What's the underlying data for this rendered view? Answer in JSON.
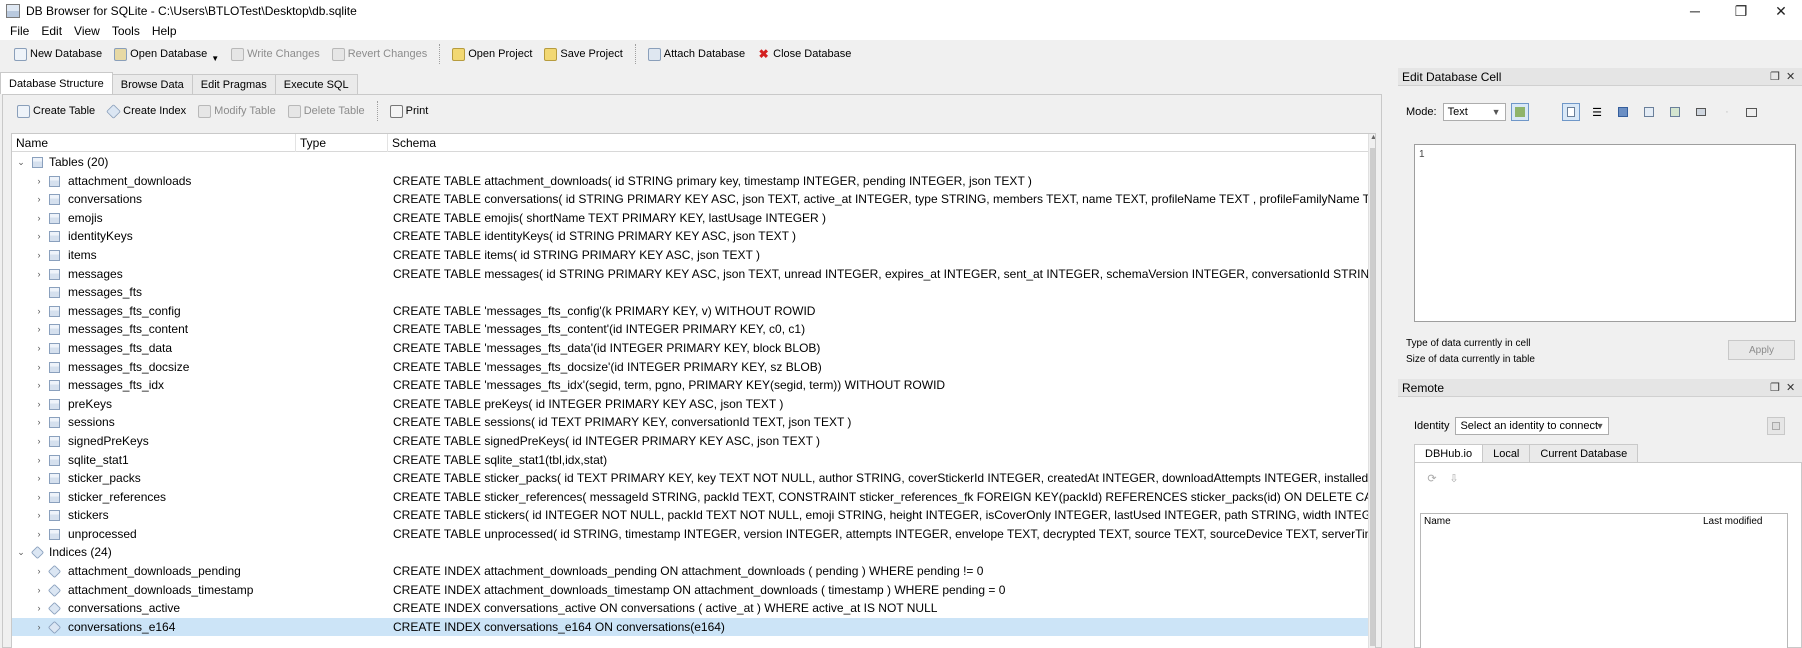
{
  "window": {
    "title": "DB Browser for SQLite - C:\\Users\\BTLOTest\\Desktop\\db.sqlite",
    "minimize": "─",
    "restore": "❐",
    "close": "✕"
  },
  "menu": [
    "File",
    "Edit",
    "View",
    "Tools",
    "Help"
  ],
  "toolbar": {
    "new_database": "New Database",
    "open_database": "Open Database",
    "write_changes": "Write Changes",
    "revert_changes": "Revert Changes",
    "open_project": "Open Project",
    "save_project": "Save Project",
    "attach_database": "Attach Database",
    "close_database": "Close Database"
  },
  "tabs": [
    "Database Structure",
    "Browse Data",
    "Edit Pragmas",
    "Execute SQL"
  ],
  "structure_toolbar": {
    "create_table": "Create Table",
    "create_index": "Create Index",
    "modify_table": "Modify Table",
    "delete_table": "Delete Table",
    "print": "Print"
  },
  "tree": {
    "headers": [
      "Name",
      "Type",
      "Schema"
    ],
    "tables_label": "Tables (20)",
    "tables": [
      {
        "name": "attachment_downloads",
        "schema": "CREATE TABLE attachment_downloads( id STRING primary key, timestamp INTEGER, pending INTEGER, json TEXT )"
      },
      {
        "name": "conversations",
        "schema": "CREATE TABLE conversations( id STRING PRIMARY KEY ASC, json TEXT, active_at INTEGER, type STRING, members TEXT, name TEXT, profileName TEXT , profileFamilyName TEXT"
      },
      {
        "name": "emojis",
        "schema": "CREATE TABLE emojis( shortName TEXT PRIMARY KEY, lastUsage INTEGER )"
      },
      {
        "name": "identityKeys",
        "schema": "CREATE TABLE identityKeys( id STRING PRIMARY KEY ASC, json TEXT )"
      },
      {
        "name": "items",
        "schema": "CREATE TABLE items( id STRING PRIMARY KEY ASC, json TEXT )"
      },
      {
        "name": "messages",
        "schema": "CREATE TABLE messages( id STRING PRIMARY KEY ASC, json TEXT, unread INTEGER, expires_at INTEGER, sent_at INTEGER, schemaVersion INTEGER, conversationId STRING, recei"
      },
      {
        "name": "messages_fts",
        "schema": ""
      },
      {
        "name": "messages_fts_config",
        "schema": "CREATE TABLE 'messages_fts_config'(k PRIMARY KEY, v) WITHOUT ROWID"
      },
      {
        "name": "messages_fts_content",
        "schema": "CREATE TABLE 'messages_fts_content'(id INTEGER PRIMARY KEY, c0, c1)"
      },
      {
        "name": "messages_fts_data",
        "schema": "CREATE TABLE 'messages_fts_data'(id INTEGER PRIMARY KEY, block BLOB)"
      },
      {
        "name": "messages_fts_docsize",
        "schema": "CREATE TABLE 'messages_fts_docsize'(id INTEGER PRIMARY KEY, sz BLOB)"
      },
      {
        "name": "messages_fts_idx",
        "schema": "CREATE TABLE 'messages_fts_idx'(segid, term, pgno, PRIMARY KEY(segid, term)) WITHOUT ROWID"
      },
      {
        "name": "preKeys",
        "schema": "CREATE TABLE preKeys( id INTEGER PRIMARY KEY ASC, json TEXT )"
      },
      {
        "name": "sessions",
        "schema": "CREATE TABLE sessions( id TEXT PRIMARY KEY, conversationId TEXT, json TEXT )"
      },
      {
        "name": "signedPreKeys",
        "schema": "CREATE TABLE signedPreKeys( id INTEGER PRIMARY KEY ASC, json TEXT )"
      },
      {
        "name": "sqlite_stat1",
        "schema": "CREATE TABLE sqlite_stat1(tbl,idx,stat)"
      },
      {
        "name": "sticker_packs",
        "schema": "CREATE TABLE sticker_packs( id TEXT PRIMARY KEY, key TEXT NOT NULL, author STRING, coverStickerId INTEGER, createdAt INTEGER, downloadAttempts INTEGER, installedAt INTE"
      },
      {
        "name": "sticker_references",
        "schema": "CREATE TABLE sticker_references( messageId STRING, packId TEXT, CONSTRAINT sticker_references_fk FOREIGN KEY(packId) REFERENCES sticker_packs(id) ON DELETE CASCADE"
      },
      {
        "name": "stickers",
        "schema": "CREATE TABLE stickers( id INTEGER NOT NULL, packId TEXT NOT NULL, emoji STRING, height INTEGER, isCoverOnly INTEGER, lastUsed INTEGER, path STRING, width INTEGER, PRIM"
      },
      {
        "name": "unprocessed",
        "schema": "CREATE TABLE unprocessed( id STRING, timestamp INTEGER, version INTEGER, attempts INTEGER, envelope TEXT, decrypted TEXT, source TEXT, sourceDevice TEXT, serverTimest"
      }
    ],
    "indices_label": "Indices (24)",
    "indices": [
      {
        "name": "attachment_downloads_pending",
        "schema": "CREATE INDEX attachment_downloads_pending ON attachment_downloads ( pending ) WHERE pending != 0"
      },
      {
        "name": "attachment_downloads_timestamp",
        "schema": "CREATE INDEX attachment_downloads_timestamp ON attachment_downloads ( timestamp ) WHERE pending = 0"
      },
      {
        "name": "conversations_active",
        "schema": "CREATE INDEX conversations_active ON conversations ( active_at ) WHERE active_at IS NOT NULL"
      },
      {
        "name": "conversations_e164",
        "schema": "CREATE INDEX conversations_e164 ON conversations(e164)"
      }
    ]
  },
  "edit_cell": {
    "title": "Edit Database Cell",
    "mode_label": "Mode:",
    "mode_value": "Text",
    "line_number": "1",
    "type_info": "Type of data currently in cell",
    "size_info": "Size of data currently in table",
    "apply": "Apply"
  },
  "remote": {
    "title": "Remote",
    "identity_label": "Identity",
    "identity_placeholder": "Select an identity to connect",
    "tabs": [
      "DBHub.io",
      "Local",
      "Current Database"
    ],
    "list_headers": [
      "Name",
      "Last modified"
    ]
  },
  "dock_controls": {
    "float": "❐",
    "close": "✕"
  }
}
